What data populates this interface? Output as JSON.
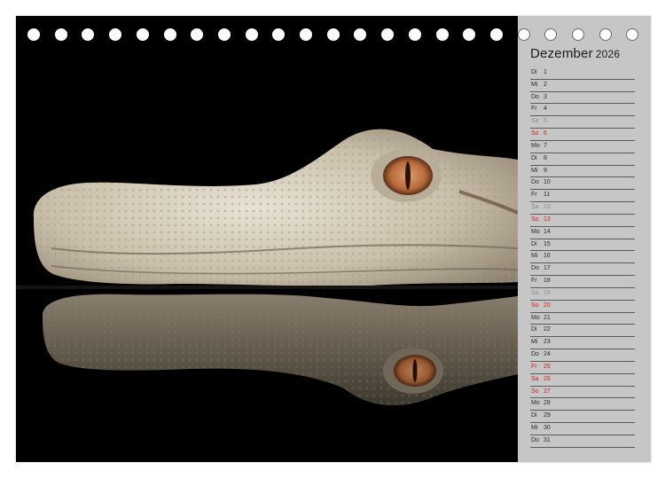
{
  "calendar": {
    "month": "Dezember",
    "year": "2026",
    "days": [
      {
        "wd": "Di",
        "d": "1",
        "type": "weekday"
      },
      {
        "wd": "Mi",
        "d": "2",
        "type": "weekday"
      },
      {
        "wd": "Do",
        "d": "3",
        "type": "weekday"
      },
      {
        "wd": "Fr",
        "d": "4",
        "type": "weekday"
      },
      {
        "wd": "Sa",
        "d": "5",
        "type": "sat"
      },
      {
        "wd": "So",
        "d": "6",
        "type": "sun"
      },
      {
        "wd": "Mo",
        "d": "7",
        "type": "weekday"
      },
      {
        "wd": "Di",
        "d": "8",
        "type": "weekday"
      },
      {
        "wd": "Mi",
        "d": "9",
        "type": "weekday"
      },
      {
        "wd": "Do",
        "d": "10",
        "type": "weekday"
      },
      {
        "wd": "Fr",
        "d": "11",
        "type": "weekday"
      },
      {
        "wd": "Sa",
        "d": "12",
        "type": "sat"
      },
      {
        "wd": "So",
        "d": "13",
        "type": "sun"
      },
      {
        "wd": "Mo",
        "d": "14",
        "type": "weekday"
      },
      {
        "wd": "Di",
        "d": "15",
        "type": "weekday"
      },
      {
        "wd": "Mi",
        "d": "16",
        "type": "weekday"
      },
      {
        "wd": "Do",
        "d": "17",
        "type": "weekday"
      },
      {
        "wd": "Fr",
        "d": "18",
        "type": "weekday"
      },
      {
        "wd": "Sa",
        "d": "19",
        "type": "sat"
      },
      {
        "wd": "So",
        "d": "20",
        "type": "sun"
      },
      {
        "wd": "Mo",
        "d": "21",
        "type": "weekday"
      },
      {
        "wd": "Di",
        "d": "22",
        "type": "weekday"
      },
      {
        "wd": "Mi",
        "d": "23",
        "type": "weekday"
      },
      {
        "wd": "Do",
        "d": "24",
        "type": "weekday"
      },
      {
        "wd": "Fr",
        "d": "25",
        "type": "holiday"
      },
      {
        "wd": "Sa",
        "d": "26",
        "type": "holiday"
      },
      {
        "wd": "So",
        "d": "27",
        "type": "sun"
      },
      {
        "wd": "Mo",
        "d": "28",
        "type": "weekday"
      },
      {
        "wd": "Di",
        "d": "29",
        "type": "weekday"
      },
      {
        "wd": "Mi",
        "d": "30",
        "type": "weekday"
      },
      {
        "wd": "Do",
        "d": "31",
        "type": "weekday"
      }
    ]
  },
  "photo": {
    "icon": "albino-alligator-reflection-photo"
  },
  "colors": {
    "panel": "#c6c6c6",
    "holiday_red": "#d2201a",
    "saturday_grey": "#8a8a8a",
    "photo_background": "#000000"
  }
}
